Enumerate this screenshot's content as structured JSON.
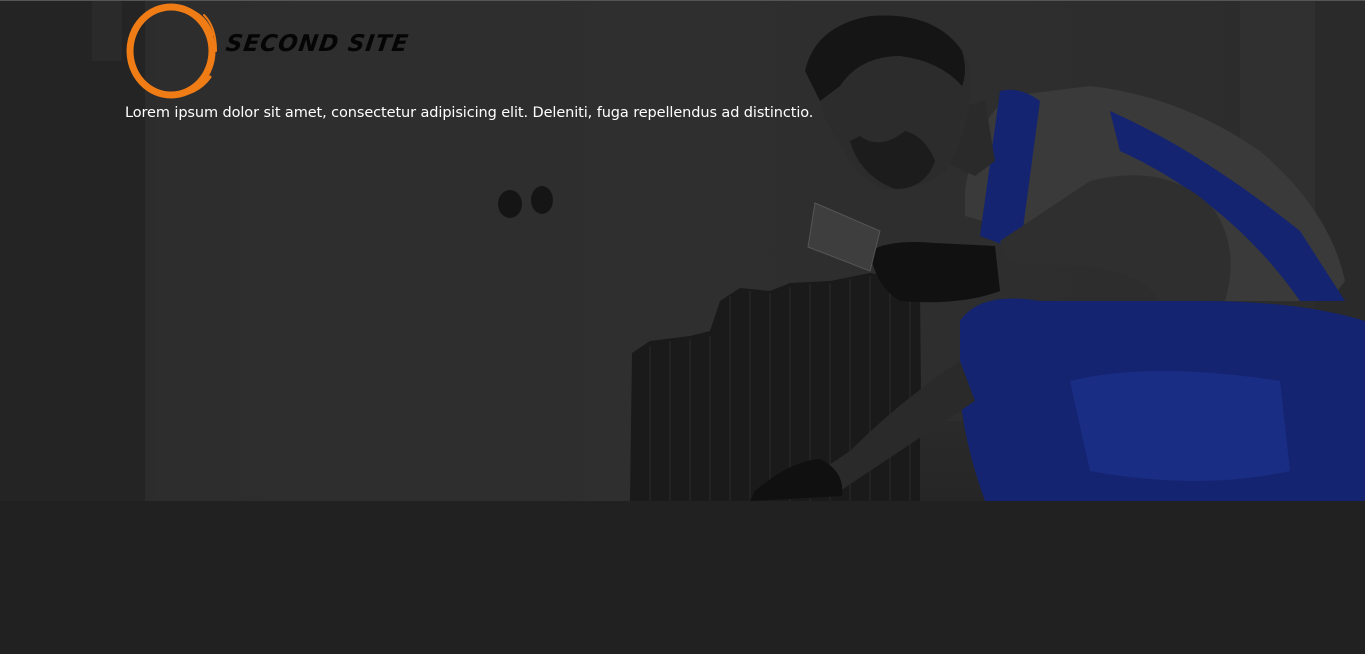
{
  "site": {
    "name": "Second Site",
    "tagline": "Lorem ipsum dolor sit amet, consectetur adipisicing elit. Deleniti, fuga repellendus ad distinctio."
  },
  "hero": {
    "image_subject": "worker-applying-tile-adhesive-with-trowel"
  },
  "colors": {
    "page_background": "#212121",
    "logo_ring": "#f07c16",
    "logo_text": "#050505",
    "tagline_text": "#ffffff",
    "overalls": "#1b2f8a"
  }
}
